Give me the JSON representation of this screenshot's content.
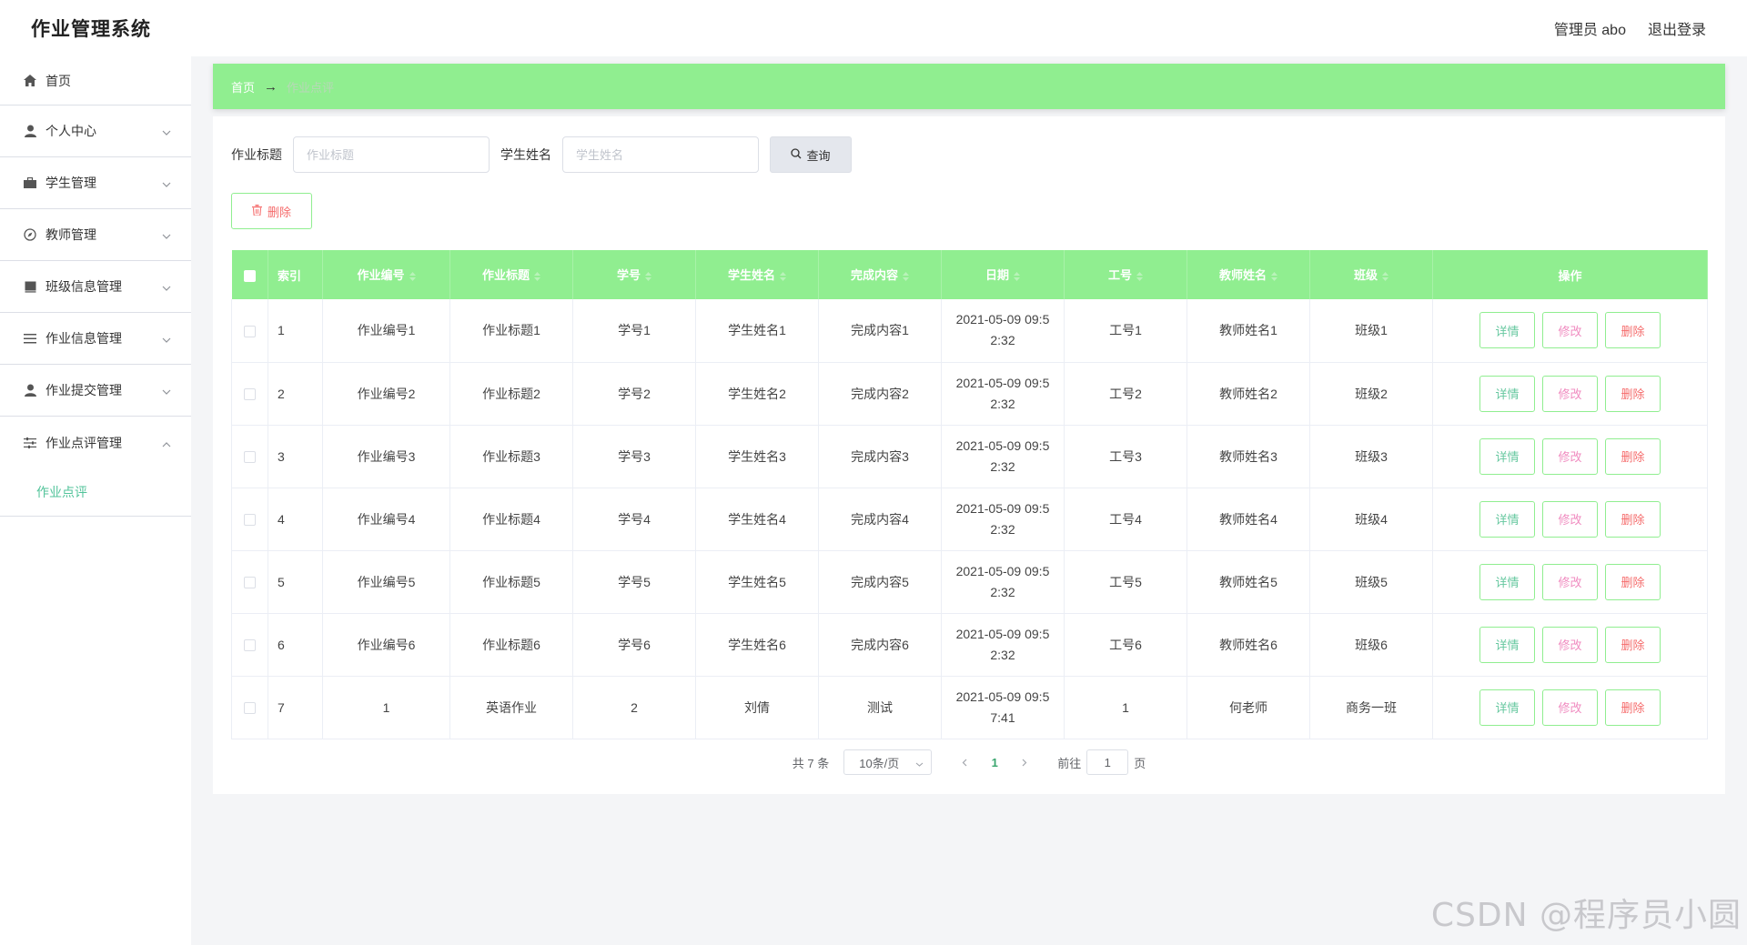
{
  "header": {
    "title": "作业管理系统",
    "user_label": "管理员 abo",
    "logout_label": "退出登录"
  },
  "sidebar": {
    "items": [
      {
        "label": "首页",
        "icon": "home-icon",
        "has_chevron": false
      },
      {
        "label": "个人中心",
        "icon": "user-icon",
        "has_chevron": true
      },
      {
        "label": "学生管理",
        "icon": "briefcase-icon",
        "has_chevron": true
      },
      {
        "label": "教师管理",
        "icon": "compass-icon",
        "has_chevron": true
      },
      {
        "label": "班级信息管理",
        "icon": "book-icon",
        "has_chevron": true
      },
      {
        "label": "作业信息管理",
        "icon": "list-icon",
        "has_chevron": true
      },
      {
        "label": "作业提交管理",
        "icon": "user-icon",
        "has_chevron": true
      },
      {
        "label": "作业点评管理",
        "icon": "sliders-icon",
        "has_chevron": true,
        "expanded": true
      }
    ],
    "submenu_active": "作业点评"
  },
  "breadcrumb": {
    "home": "首页",
    "arrow": "→",
    "current": "作业点评"
  },
  "search": {
    "title_label": "作业标题",
    "title_placeholder": "作业标题",
    "student_label": "学生姓名",
    "student_placeholder": "学生姓名",
    "query_label": "查询"
  },
  "toolbar": {
    "delete_label": "删除"
  },
  "table": {
    "columns": [
      "索引",
      "作业编号",
      "作业标题",
      "学号",
      "学生姓名",
      "完成内容",
      "日期",
      "工号",
      "教师姓名",
      "班级",
      "操作"
    ],
    "rows": [
      {
        "index": "1",
        "code": "作业编号1",
        "title": "作业标题1",
        "student_no": "学号1",
        "student_name": "学生姓名1",
        "content": "完成内容1",
        "date_l1": "2021-05-09 09:5",
        "date_l2": "2:32",
        "work_no": "工号1",
        "teacher": "教师姓名1",
        "class": "班级1"
      },
      {
        "index": "2",
        "code": "作业编号2",
        "title": "作业标题2",
        "student_no": "学号2",
        "student_name": "学生姓名2",
        "content": "完成内容2",
        "date_l1": "2021-05-09 09:5",
        "date_l2": "2:32",
        "work_no": "工号2",
        "teacher": "教师姓名2",
        "class": "班级2"
      },
      {
        "index": "3",
        "code": "作业编号3",
        "title": "作业标题3",
        "student_no": "学号3",
        "student_name": "学生姓名3",
        "content": "完成内容3",
        "date_l1": "2021-05-09 09:5",
        "date_l2": "2:32",
        "work_no": "工号3",
        "teacher": "教师姓名3",
        "class": "班级3"
      },
      {
        "index": "4",
        "code": "作业编号4",
        "title": "作业标题4",
        "student_no": "学号4",
        "student_name": "学生姓名4",
        "content": "完成内容4",
        "date_l1": "2021-05-09 09:5",
        "date_l2": "2:32",
        "work_no": "工号4",
        "teacher": "教师姓名4",
        "class": "班级4"
      },
      {
        "index": "5",
        "code": "作业编号5",
        "title": "作业标题5",
        "student_no": "学号5",
        "student_name": "学生姓名5",
        "content": "完成内容5",
        "date_l1": "2021-05-09 09:5",
        "date_l2": "2:32",
        "work_no": "工号5",
        "teacher": "教师姓名5",
        "class": "班级5"
      },
      {
        "index": "6",
        "code": "作业编号6",
        "title": "作业标题6",
        "student_no": "学号6",
        "student_name": "学生姓名6",
        "content": "完成内容6",
        "date_l1": "2021-05-09 09:5",
        "date_l2": "2:32",
        "work_no": "工号6",
        "teacher": "教师姓名6",
        "class": "班级6"
      },
      {
        "index": "7",
        "code": "1",
        "title": "英语作业",
        "student_no": "2",
        "student_name": "刘倩",
        "content": "测试",
        "date_l1": "2021-05-09 09:5",
        "date_l2": "7:41",
        "work_no": "1",
        "teacher": "何老师",
        "class": "商务一班"
      }
    ],
    "op_labels": {
      "detail": "详情",
      "edit": "修改",
      "delete": "删除"
    }
  },
  "pagination": {
    "total_text": "共 7 条",
    "page_size": "10条/页",
    "current_page": "1",
    "goto_prefix": "前往",
    "goto_value": "1",
    "goto_suffix": "页"
  },
  "watermark": "CSDN @程序员小圆",
  "colors": {
    "accent_green": "#90ee90",
    "submenu_active": "#52c39a",
    "delete_red": "#f56c6c",
    "edit_pink": "#f08cc0",
    "detail_green": "#67c8a0"
  }
}
